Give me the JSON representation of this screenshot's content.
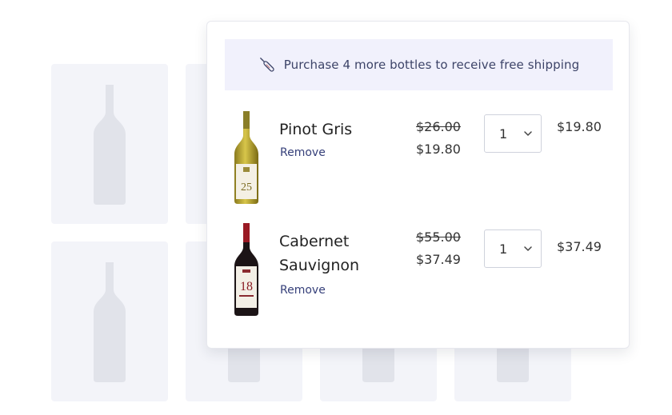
{
  "banner": {
    "icon": "wine-bottle-icon",
    "text": "Purchase 4 more bottles to receive free shipping"
  },
  "cart_items": [
    {
      "name": "Pinot Gris",
      "remove_label": "Remove",
      "original_price": "$26.00",
      "sale_price": "$19.80",
      "quantity": "1",
      "line_total": "$19.80",
      "label_text": "25"
    },
    {
      "name": "Cabernet Sauvignon",
      "remove_label": "Remove",
      "original_price": "$55.00",
      "sale_price": "$37.49",
      "quantity": "1",
      "line_total": "$37.49",
      "label_text": "18"
    }
  ],
  "colors": {
    "banner_bg": "#f1f1fc",
    "banner_text": "#3d4468",
    "remove_link": "#36407a",
    "placeholder_tile": "#f3f4f9",
    "placeholder_bottle": "#e1e3ea"
  }
}
